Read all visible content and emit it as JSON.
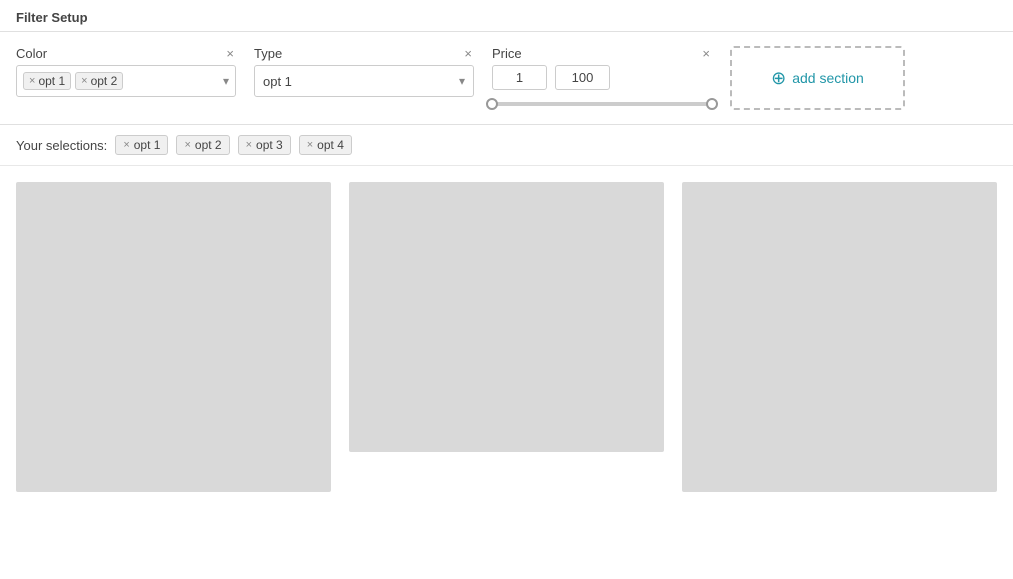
{
  "page": {
    "title": "Filter Setup"
  },
  "filter_bar": {
    "color": {
      "label": "Color",
      "close": "×",
      "tags": [
        {
          "text": "opt 1",
          "x": "×"
        },
        {
          "text": "opt 2",
          "x": "×"
        }
      ],
      "arrow": "▾"
    },
    "type": {
      "label": "Type",
      "close": "×",
      "value": "opt 1",
      "arrow": "▾"
    },
    "price": {
      "label": "Price",
      "close": "×",
      "min_value": "1",
      "max_value": "100",
      "slider_min_pct": 0,
      "slider_max_pct": 100
    },
    "add_section": {
      "icon": "⊕",
      "label": "add section"
    }
  },
  "selections": {
    "label": "Your selections:",
    "tags": [
      {
        "text": "opt 1",
        "x": "×"
      },
      {
        "text": "opt 2",
        "x": "×"
      },
      {
        "text": "opt 3",
        "x": "×"
      },
      {
        "text": "opt 4",
        "x": "×"
      }
    ]
  },
  "content_cards": [
    {
      "id": 1
    },
    {
      "id": 2
    },
    {
      "id": 3
    }
  ]
}
